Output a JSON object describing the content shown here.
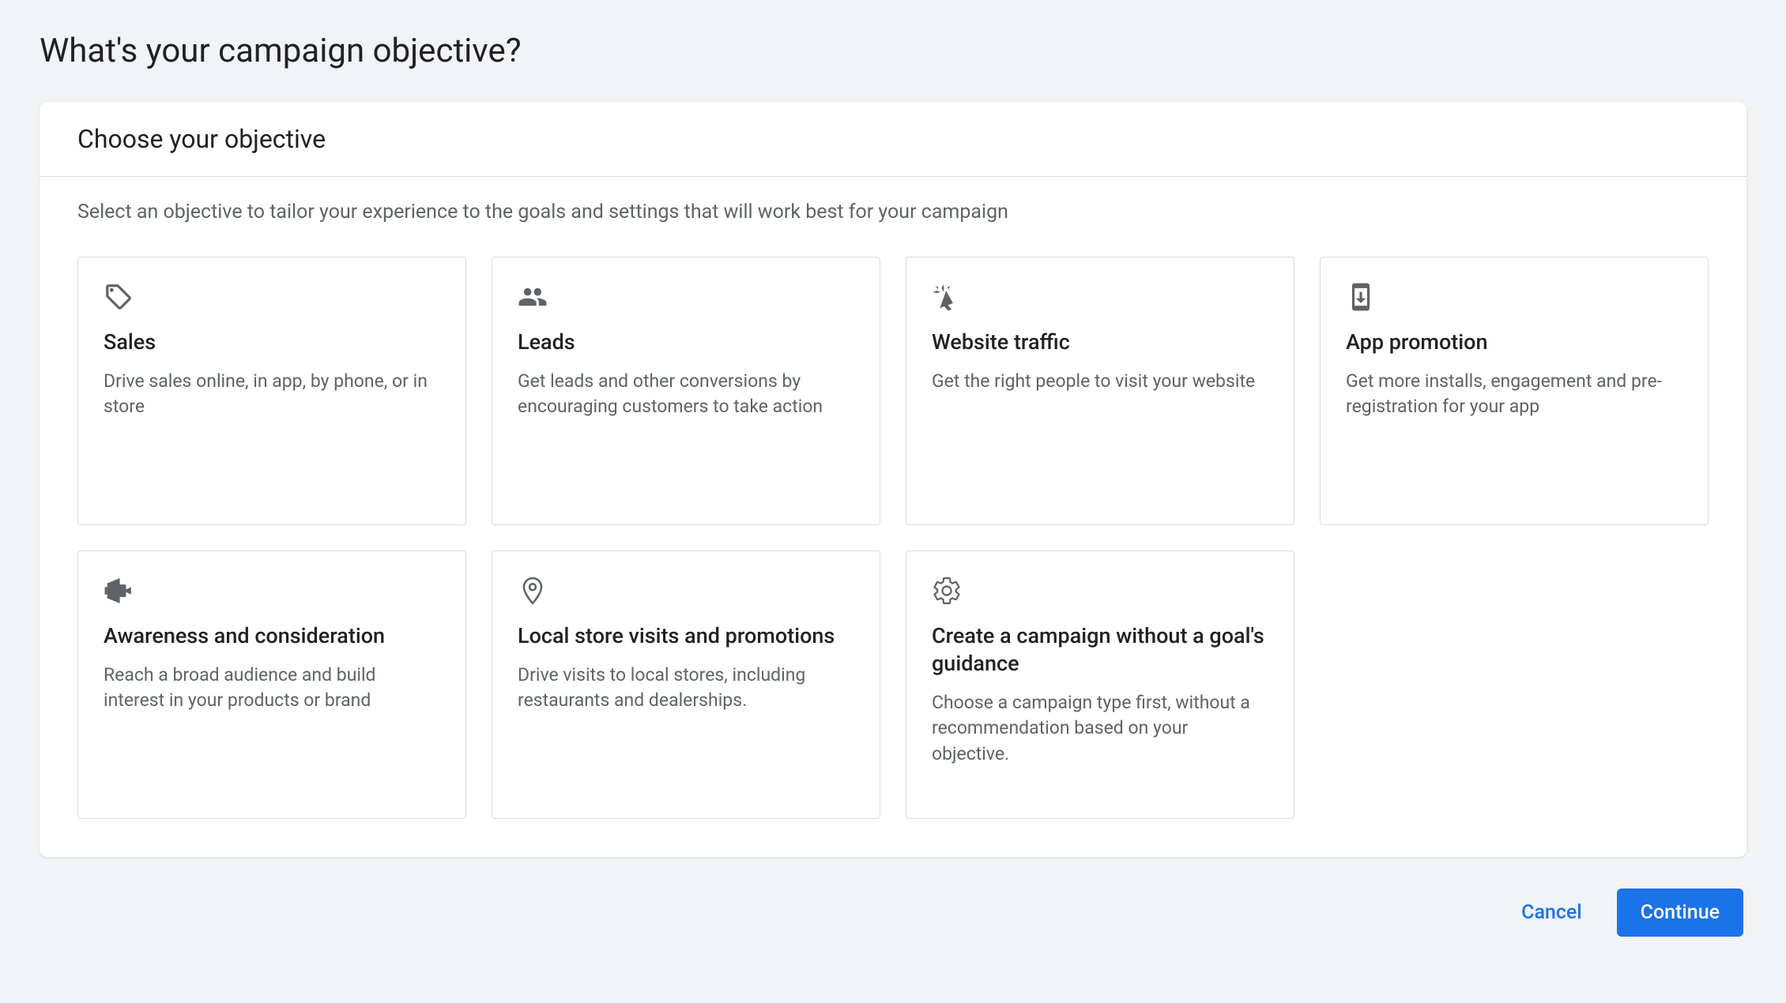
{
  "page_title": "What's your campaign objective?",
  "card": {
    "header_title": "Choose your objective",
    "helper_text": "Select an objective to tailor your experience to the goals and settings that will work best for your campaign"
  },
  "options": [
    {
      "title": "Sales",
      "description": "Drive sales online, in app, by phone, or in store"
    },
    {
      "title": "Leads",
      "description": "Get leads and other conversions by encouraging customers to take action"
    },
    {
      "title": "Website traffic",
      "description": "Get the right people to visit your website"
    },
    {
      "title": "App promotion",
      "description": "Get more installs, engagement and pre-registration for your app"
    },
    {
      "title": "Awareness and consideration",
      "description": "Reach a broad audience and build interest in your products or brand"
    },
    {
      "title": "Local store visits and promotions",
      "description": "Drive visits to local stores, including restaurants and dealerships."
    },
    {
      "title": "Create a campaign without a goal's guidance",
      "description": "Choose a campaign type first, without a recommendation based on your objective."
    }
  ],
  "footer": {
    "cancel": "Cancel",
    "continue": "Continue"
  }
}
